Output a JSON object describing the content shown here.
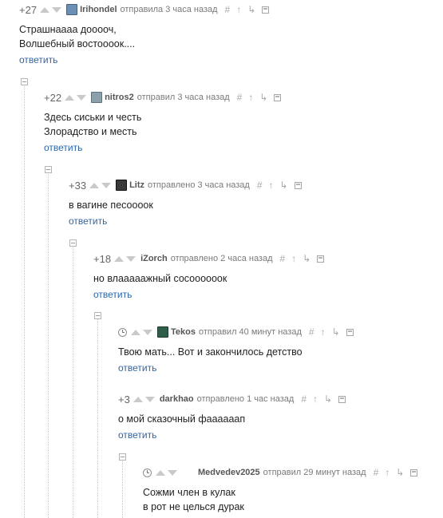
{
  "comments": [
    {
      "rating": "+27",
      "author": "Irihondel",
      "meta": "отправила 3 часа назад",
      "lines": [
        "Страшнаааа дооооч,",
        "Волшебный востоооок...."
      ],
      "reply": "ответить",
      "avatar_color": "#6b8fb5"
    },
    {
      "rating": "+22",
      "author": "nitros2",
      "meta": "отправил 3 часа назад",
      "lines": [
        "Здесь сиськи и честь",
        "Злорадство и месть"
      ],
      "reply": "ответить",
      "avatar_color": "#8aa0aa"
    },
    {
      "rating": "+33",
      "author": "Litz",
      "meta": "отправлено 3 часа назад",
      "lines": [
        "в вагине песоооок"
      ],
      "reply": "ответить",
      "avatar_color": "#3a3a3a"
    },
    {
      "rating": "+18",
      "author": "iZorch",
      "meta": "отправлено 2 часа назад",
      "lines": [
        "но влааааажный сосоооооок"
      ],
      "reply": "ответить"
    },
    {
      "author": "Tekos",
      "meta": "отправил 40 минут назад",
      "lines": [
        "Твою мать... Вот и закончилось детство"
      ],
      "reply": "ответить",
      "avatar_color": "#2f5f4a"
    },
    {
      "rating": "+3",
      "author": "darkhao",
      "meta": "отправлено 1 час назад",
      "lines": [
        "о мой сказочный фаааааап"
      ],
      "reply": "ответить"
    },
    {
      "author": "Medvedev2025",
      "meta": "отправил 29 минут назад",
      "lines": [
        "Сожми член в кулак",
        "в рот не целься дурак"
      ]
    }
  ],
  "actions": {
    "hash": "#",
    "up": "↑",
    "branch": "↳"
  },
  "icons": {
    "clock": "clock-icon",
    "vote_up": "vote-up-icon",
    "vote_down": "vote-down-icon",
    "save": "save-icon"
  },
  "colors": {
    "link": "#2d66a8",
    "author": "#555555",
    "meta": "#7a7a7a",
    "vote": "#c9c9c9"
  }
}
